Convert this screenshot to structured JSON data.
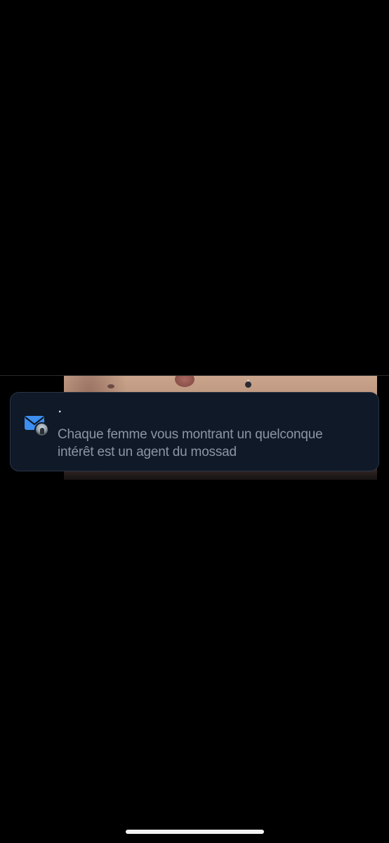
{
  "notification": {
    "sender": "·",
    "message": "Chaque femme vous montrant un quelconque\nintérêt est un agent du mossad",
    "app_icon": "mail-icon",
    "avatar": "avatar-image"
  },
  "colors": {
    "background": "#000000",
    "notification_bg": "#0f1927",
    "message_text": "#8b96a3",
    "mail_icon": "#3d8ef0"
  },
  "system": {
    "home_indicator": "home-indicator"
  }
}
